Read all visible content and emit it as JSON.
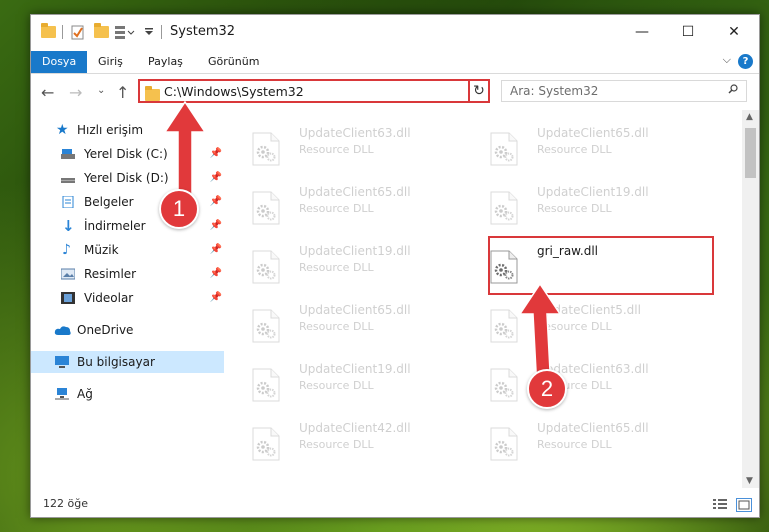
{
  "window": {
    "title": "System32",
    "controls": {
      "minimize": "—",
      "maximize": "☐",
      "close": "✕"
    }
  },
  "ribbon": {
    "tabs": [
      {
        "label": "Dosya",
        "active": true
      },
      {
        "label": "Giriş"
      },
      {
        "label": "Paylaş"
      },
      {
        "label": "Görünüm"
      }
    ],
    "help": "?"
  },
  "nav": {
    "address": "C:\\Windows\\System32",
    "search_placeholder": "Ara: System32"
  },
  "sidebar": {
    "items": [
      {
        "label": "Hızlı erişim",
        "icon": "star-icon"
      },
      {
        "label": "Yerel Disk (C:)",
        "icon": "drive-icon",
        "pinned": true
      },
      {
        "label": "Yerel Disk (D:)",
        "icon": "drive-icon",
        "pinned": true
      },
      {
        "label": "Belgeler",
        "icon": "documents-icon",
        "pinned": true
      },
      {
        "label": "İndirmeler",
        "icon": "download-icon",
        "pinned": true
      },
      {
        "label": "Müzik",
        "icon": "music-icon",
        "pinned": true
      },
      {
        "label": "Resimler",
        "icon": "pictures-icon",
        "pinned": true
      },
      {
        "label": "Videolar",
        "icon": "video-icon",
        "pinned": true
      },
      {
        "label": "OneDrive",
        "icon": "cloud-icon"
      },
      {
        "label": "Bu bilgisayar",
        "icon": "computer-icon",
        "selected": true
      },
      {
        "label": "Ağ",
        "icon": "network-icon"
      }
    ]
  },
  "files": [
    {
      "name": "UpdateClient63.dll",
      "desc": "Resource DLL"
    },
    {
      "name": "UpdateClient65.dll",
      "desc": "Resource DLL"
    },
    {
      "name": "UpdateClient65.dll",
      "desc": "Resource DLL"
    },
    {
      "name": "UpdateClient19.dll",
      "desc": "Resource DLL"
    },
    {
      "name": "UpdateClient19.dll",
      "desc": "Resource DLL"
    },
    {
      "name": "gri_raw.dll",
      "desc": "",
      "highlight": true
    },
    {
      "name": "UpdateClient65.dll",
      "desc": "Resource DLL"
    },
    {
      "name": "UpdateClient5.dll",
      "desc": "Resource DLL"
    },
    {
      "name": "UpdateClient19.dll",
      "desc": "Resource DLL"
    },
    {
      "name": "UpdateClient63.dll",
      "desc": "Resource DLL"
    },
    {
      "name": "UpdateClient42.dll",
      "desc": "Resource DLL"
    },
    {
      "name": "UpdateClient65.dll",
      "desc": "Resource DLL"
    }
  ],
  "status": {
    "count": "122 öğe"
  },
  "annotations": {
    "step1": "1",
    "step2": "2",
    "color": "#e1393b"
  }
}
